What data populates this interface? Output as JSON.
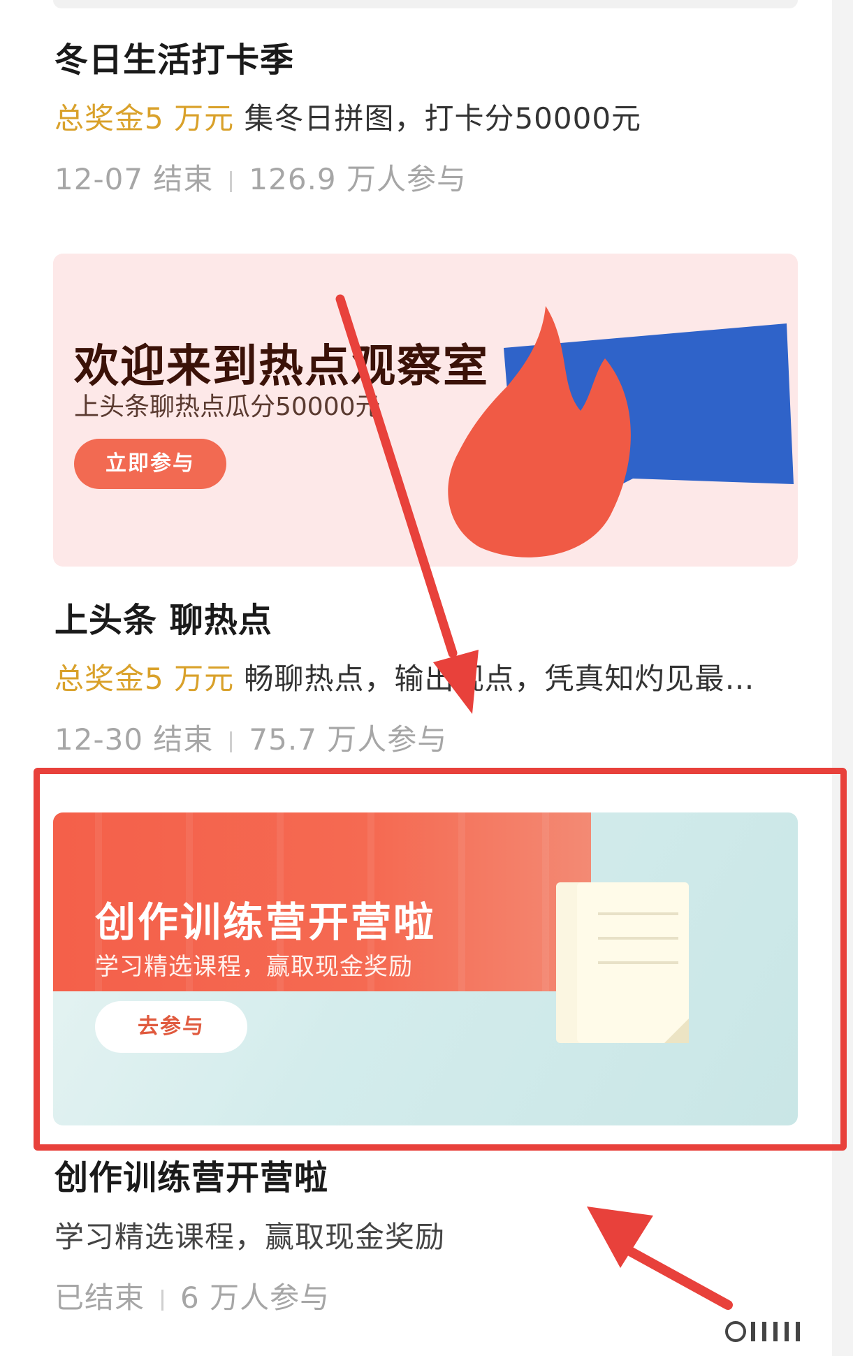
{
  "feed": [
    {
      "title": "冬日生活打卡季",
      "prize": "总奖金5 万元",
      "description": "集冬日拼图，打卡分50000元",
      "end": "12-07 结束",
      "participants": "126.9 万人参与"
    },
    {
      "banner": {
        "headline": "欢迎来到热点观察室",
        "subline": "上头条聊热点瓜分50000元",
        "button": "立即参与"
      },
      "title": "上头条 聊热点",
      "prize": "总奖金5 万元",
      "description": "畅聊热点，输出观点，凭真知灼见最…",
      "end": "12-30 结束",
      "participants": "75.7 万人参与"
    },
    {
      "banner": {
        "headline": "创作训练营开营啦",
        "subline": "学习精选课程，赢取现金奖励",
        "button": "去参与"
      },
      "title": "创作训练营开营啦",
      "description": "学习精选课程，赢取现金奖励",
      "end": "已结束",
      "participants": "6 万人参与"
    }
  ],
  "colors": {
    "prize": "#d9a12a",
    "annotation": "#e8413b",
    "banner1_button": "#f26a52",
    "banner2_red": "#f4604a"
  },
  "annotations": [
    "red-highlight-box",
    "red-arrow-down",
    "red-arrow-up"
  ]
}
